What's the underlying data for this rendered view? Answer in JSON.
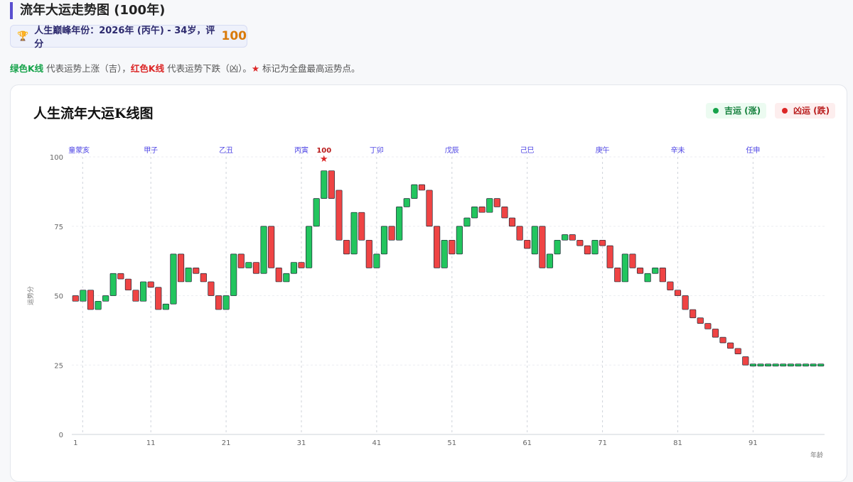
{
  "header": {
    "title": "流年大运走势图 (100年)",
    "peak_text": "人生巅峰年份：2026年 (丙午) - 34岁，评分",
    "peak_score": "100"
  },
  "legend_note": {
    "green_label": "绿色K线",
    "green_text": " 代表运势上涨（吉），",
    "red_label": "红色K线",
    "red_text": " 代表运势下跌（凶）。",
    "star_glyph": "★",
    "star_text": " 标记为全盘最高运势点。"
  },
  "chart": {
    "title": "人生流年大运K线图",
    "legend_up": "吉运 (涨)",
    "legend_down": "凶运 (跌)"
  },
  "colors": {
    "up": "#22c55e",
    "down": "#ef4444",
    "outline": "#1f2937",
    "accent": "#5a4fcf"
  },
  "chart_data": {
    "type": "candlestick",
    "title": "人生流年大运K线图",
    "xlabel": "年龄",
    "ylabel": "运势分",
    "xlim": [
      1,
      100
    ],
    "ylim": [
      0,
      100
    ],
    "y_ticks": [
      0,
      25,
      50,
      75,
      100
    ],
    "x_ticks": [
      1,
      11,
      21,
      31,
      41,
      51,
      61,
      71,
      81,
      91
    ],
    "grid": true,
    "legend_position": "top-right",
    "dayun": [
      {
        "age": 1,
        "name": "童蒙亥"
      },
      {
        "age": 11,
        "name": "甲子"
      },
      {
        "age": 21,
        "name": "乙丑"
      },
      {
        "age": 31,
        "name": "丙寅"
      },
      {
        "age": 41,
        "name": "丁卯"
      },
      {
        "age": 51,
        "name": "戊辰"
      },
      {
        "age": 61,
        "name": "己巳"
      },
      {
        "age": 71,
        "name": "庚午"
      },
      {
        "age": 81,
        "name": "辛未"
      },
      {
        "age": 91,
        "name": "任申"
      }
    ],
    "peak": {
      "age": 34,
      "score": 100
    },
    "candles": [
      {
        "age": 1,
        "open": 50,
        "close": 48
      },
      {
        "age": 2,
        "open": 48,
        "close": 52
      },
      {
        "age": 3,
        "open": 52,
        "close": 45
      },
      {
        "age": 4,
        "open": 45,
        "close": 48
      },
      {
        "age": 5,
        "open": 48,
        "close": 50
      },
      {
        "age": 6,
        "open": 50,
        "close": 58
      },
      {
        "age": 7,
        "open": 58,
        "close": 56
      },
      {
        "age": 8,
        "open": 56,
        "close": 52
      },
      {
        "age": 9,
        "open": 52,
        "close": 48
      },
      {
        "age": 10,
        "open": 48,
        "close": 55
      },
      {
        "age": 11,
        "open": 55,
        "close": 53
      },
      {
        "age": 12,
        "open": 53,
        "close": 45
      },
      {
        "age": 13,
        "open": 45,
        "close": 47
      },
      {
        "age": 14,
        "open": 47,
        "close": 65
      },
      {
        "age": 15,
        "open": 65,
        "close": 55
      },
      {
        "age": 16,
        "open": 55,
        "close": 60
      },
      {
        "age": 17,
        "open": 60,
        "close": 58
      },
      {
        "age": 18,
        "open": 58,
        "close": 55
      },
      {
        "age": 19,
        "open": 55,
        "close": 50
      },
      {
        "age": 20,
        "open": 50,
        "close": 45
      },
      {
        "age": 21,
        "open": 45,
        "close": 50
      },
      {
        "age": 22,
        "open": 50,
        "close": 65
      },
      {
        "age": 23,
        "open": 65,
        "close": 60
      },
      {
        "age": 24,
        "open": 60,
        "close": 62
      },
      {
        "age": 25,
        "open": 62,
        "close": 58
      },
      {
        "age": 26,
        "open": 58,
        "close": 75
      },
      {
        "age": 27,
        "open": 75,
        "close": 60
      },
      {
        "age": 28,
        "open": 60,
        "close": 55
      },
      {
        "age": 29,
        "open": 55,
        "close": 58
      },
      {
        "age": 30,
        "open": 58,
        "close": 62
      },
      {
        "age": 31,
        "open": 62,
        "close": 60
      },
      {
        "age": 32,
        "open": 60,
        "close": 75
      },
      {
        "age": 33,
        "open": 75,
        "close": 85
      },
      {
        "age": 34,
        "open": 85,
        "close": 95
      },
      {
        "age": 35,
        "open": 95,
        "close": 85
      },
      {
        "age": 36,
        "open": 88,
        "close": 70
      },
      {
        "age": 37,
        "open": 70,
        "close": 65
      },
      {
        "age": 38,
        "open": 65,
        "close": 80
      },
      {
        "age": 39,
        "open": 80,
        "close": 70
      },
      {
        "age": 40,
        "open": 70,
        "close": 60
      },
      {
        "age": 41,
        "open": 60,
        "close": 65
      },
      {
        "age": 42,
        "open": 65,
        "close": 75
      },
      {
        "age": 43,
        "open": 75,
        "close": 70
      },
      {
        "age": 44,
        "open": 70,
        "close": 82
      },
      {
        "age": 45,
        "open": 82,
        "close": 85
      },
      {
        "age": 46,
        "open": 85,
        "close": 90
      },
      {
        "age": 47,
        "open": 90,
        "close": 88
      },
      {
        "age": 48,
        "open": 88,
        "close": 75
      },
      {
        "age": 49,
        "open": 75,
        "close": 60
      },
      {
        "age": 50,
        "open": 60,
        "close": 70
      },
      {
        "age": 51,
        "open": 70,
        "close": 65
      },
      {
        "age": 52,
        "open": 65,
        "close": 75
      },
      {
        "age": 53,
        "open": 75,
        "close": 78
      },
      {
        "age": 54,
        "open": 78,
        "close": 82
      },
      {
        "age": 55,
        "open": 82,
        "close": 80
      },
      {
        "age": 56,
        "open": 80,
        "close": 85
      },
      {
        "age": 57,
        "open": 85,
        "close": 82
      },
      {
        "age": 58,
        "open": 82,
        "close": 78
      },
      {
        "age": 59,
        "open": 78,
        "close": 75
      },
      {
        "age": 60,
        "open": 75,
        "close": 70
      },
      {
        "age": 61,
        "open": 70,
        "close": 67
      },
      {
        "age": 62,
        "open": 65,
        "close": 75
      },
      {
        "age": 63,
        "open": 75,
        "close": 60
      },
      {
        "age": 64,
        "open": 60,
        "close": 65
      },
      {
        "age": 65,
        "open": 65,
        "close": 70
      },
      {
        "age": 66,
        "open": 70,
        "close": 72
      },
      {
        "age": 67,
        "open": 72,
        "close": 70
      },
      {
        "age": 68,
        "open": 70,
        "close": 68
      },
      {
        "age": 69,
        "open": 68,
        "close": 65
      },
      {
        "age": 70,
        "open": 65,
        "close": 70
      },
      {
        "age": 71,
        "open": 70,
        "close": 68
      },
      {
        "age": 72,
        "open": 68,
        "close": 60
      },
      {
        "age": 73,
        "open": 60,
        "close": 55
      },
      {
        "age": 74,
        "open": 55,
        "close": 65
      },
      {
        "age": 75,
        "open": 65,
        "close": 60
      },
      {
        "age": 76,
        "open": 60,
        "close": 58
      },
      {
        "age": 77,
        "open": 55,
        "close": 58
      },
      {
        "age": 78,
        "open": 58,
        "close": 60
      },
      {
        "age": 79,
        "open": 60,
        "close": 55
      },
      {
        "age": 80,
        "open": 55,
        "close": 52
      },
      {
        "age": 81,
        "open": 52,
        "close": 50
      },
      {
        "age": 82,
        "open": 50,
        "close": 45
      },
      {
        "age": 83,
        "open": 45,
        "close": 42
      },
      {
        "age": 84,
        "open": 42,
        "close": 40
      },
      {
        "age": 85,
        "open": 40,
        "close": 38
      },
      {
        "age": 86,
        "open": 38,
        "close": 35
      },
      {
        "age": 87,
        "open": 35,
        "close": 33
      },
      {
        "age": 88,
        "open": 33,
        "close": 31
      },
      {
        "age": 89,
        "open": 31,
        "close": 29
      },
      {
        "age": 90,
        "open": 28,
        "close": 25
      },
      {
        "age": 91,
        "open": 25,
        "close": 25
      },
      {
        "age": 92,
        "open": 25,
        "close": 25
      },
      {
        "age": 93,
        "open": 25,
        "close": 25
      },
      {
        "age": 94,
        "open": 25,
        "close": 25
      },
      {
        "age": 95,
        "open": 25,
        "close": 25
      },
      {
        "age": 96,
        "open": 25,
        "close": 25
      },
      {
        "age": 97,
        "open": 25,
        "close": 25
      },
      {
        "age": 98,
        "open": 25,
        "close": 25
      },
      {
        "age": 99,
        "open": 25,
        "close": 25
      },
      {
        "age": 100,
        "open": 25,
        "close": 25
      }
    ]
  }
}
